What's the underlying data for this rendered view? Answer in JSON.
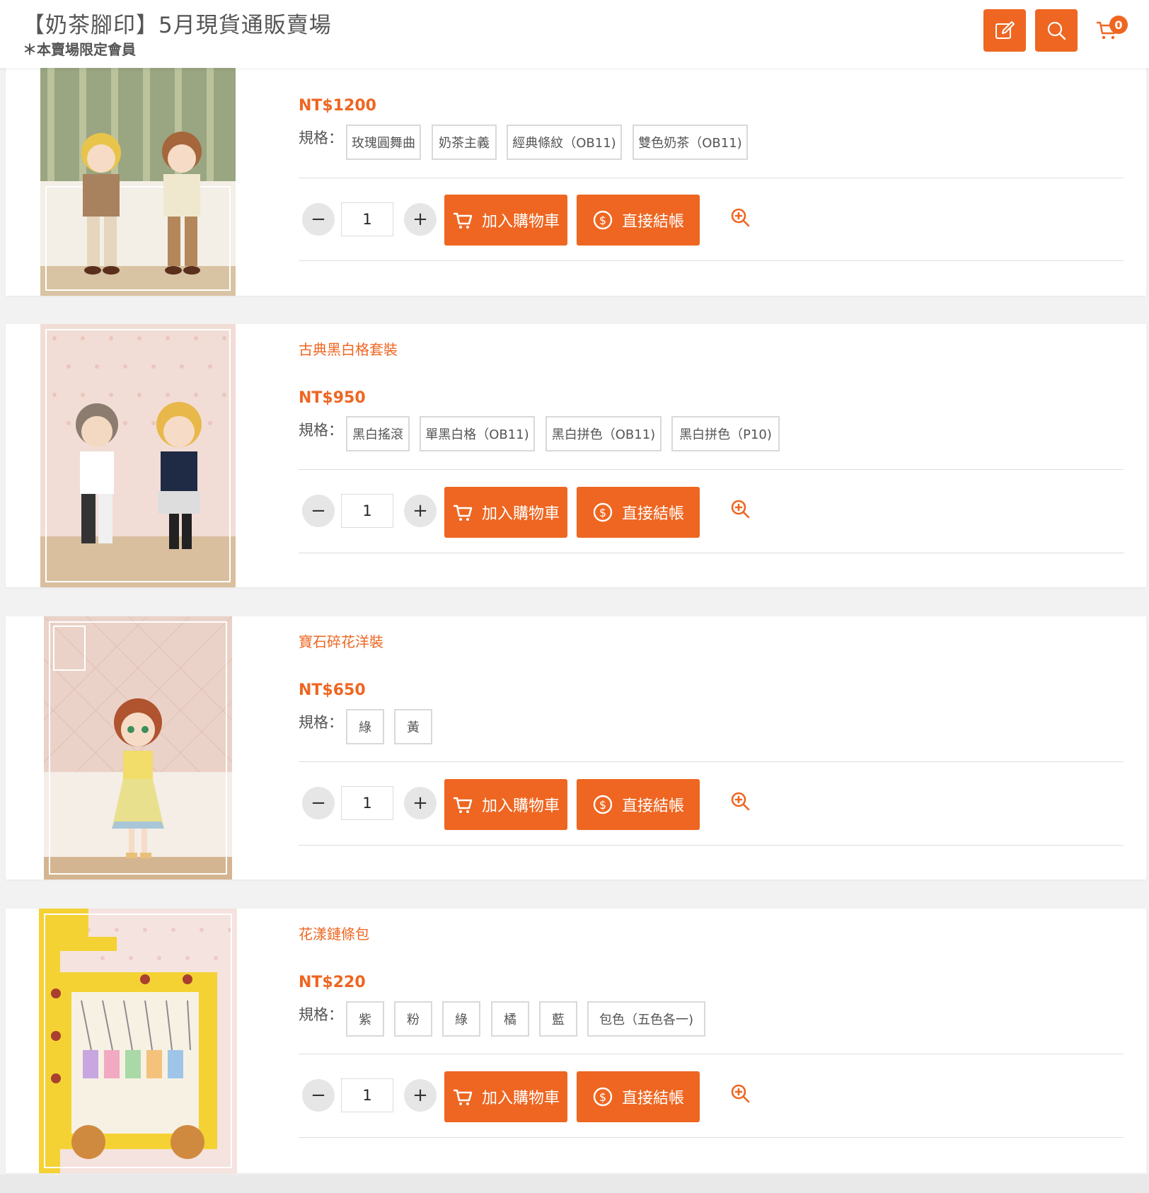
{
  "header": {
    "title": "【奶茶腳印】5月現貨通販賣場",
    "subtitle": "＊本賣場限定會員",
    "edit_icon": "edit-icon",
    "search_icon": "search-icon",
    "cart_icon": "cart-icon",
    "cart_count": "0"
  },
  "colors": {
    "accent": "#ee6621",
    "spec_border": "#d9d9d9",
    "qty_button": "#e6e6e6"
  },
  "common": {
    "spec_label": "規格：",
    "add_to_cart": "加入購物車",
    "checkout": "直接結帳",
    "qty_minus": "−",
    "qty_plus": "+"
  },
  "products": [
    {
      "name": "",
      "price": "NT$1200",
      "quantity": "1",
      "specs": [
        "玫瑰圓舞曲",
        "奶茶主義",
        "經典條紋（OB11)",
        "雙色奶茶（OB11)"
      ]
    },
    {
      "name": "古典黑白格套裝",
      "price": "NT$950",
      "quantity": "1",
      "specs": [
        "黑白搖滾",
        "單黑白格（OB11)",
        "黑白拼色（OB11)",
        "黑白拼色（P10)"
      ]
    },
    {
      "name": "寶石碎花洋裝",
      "price": "NT$650",
      "quantity": "1",
      "specs": [
        "綠",
        "黃"
      ]
    },
    {
      "name": "花漾鏈條包",
      "price": "NT$220",
      "quantity": "1",
      "specs": [
        "紫",
        "粉",
        "綠",
        "橘",
        "藍",
        "包色（五色各一)"
      ]
    }
  ]
}
